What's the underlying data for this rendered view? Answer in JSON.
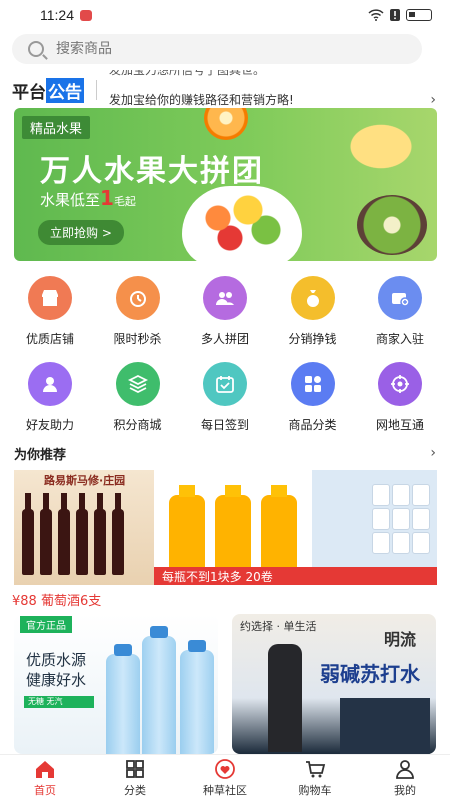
{
  "status": {
    "time": "11:24"
  },
  "search": {
    "placeholder": "搜索商品"
  },
  "notice": {
    "logo_a": "平台",
    "logo_b": "公告",
    "line1": "发加宝力想所信号了图其世。",
    "line2": "发加宝给你的赚钱路径和营销方略!"
  },
  "banner": {
    "tag": "精品水果",
    "title": "万人水果大拼团",
    "sub_prefix": "水果低至",
    "sub_num": "1",
    "sub_unit": "毛起",
    "button": "立即抢购 >"
  },
  "grid": {
    "row1": [
      {
        "label": "优质店铺",
        "color": "#f07a54"
      },
      {
        "label": "限时秒杀",
        "color": "#f5904b"
      },
      {
        "label": "多人拼团",
        "color": "#b56be0"
      },
      {
        "label": "分销挣钱",
        "color": "#f4be2c"
      },
      {
        "label": "商家入驻",
        "color": "#6b8df0"
      }
    ],
    "row2": [
      {
        "label": "好友助力",
        "color": "#9b6df2"
      },
      {
        "label": "积分商城",
        "color": "#3fbd6c"
      },
      {
        "label": "每日签到",
        "color": "#4fc7c1"
      },
      {
        "label": "商品分类",
        "color": "#5b7cf2"
      },
      {
        "label": "网地互通",
        "color": "#9a60e6"
      }
    ]
  },
  "recommend": {
    "title": "为你推荐"
  },
  "promo": {
    "wine_head": "路易斯马修·庄园",
    "strip": "每瓶不到1块多  20卷",
    "price_line": "¥88 葡萄酒6支"
  },
  "product1": {
    "badge": "官方正品",
    "line1": "优质水源",
    "line2": "健康好水",
    "feature": "无糖 无汽"
  },
  "product2": {
    "brand": "约选择 · 单生活",
    "mid": "明流",
    "big": "弱碱苏打水"
  },
  "tabs": [
    {
      "label": "首页"
    },
    {
      "label": "分类"
    },
    {
      "label": "种草社区"
    },
    {
      "label": "购物车"
    },
    {
      "label": "我的"
    }
  ]
}
